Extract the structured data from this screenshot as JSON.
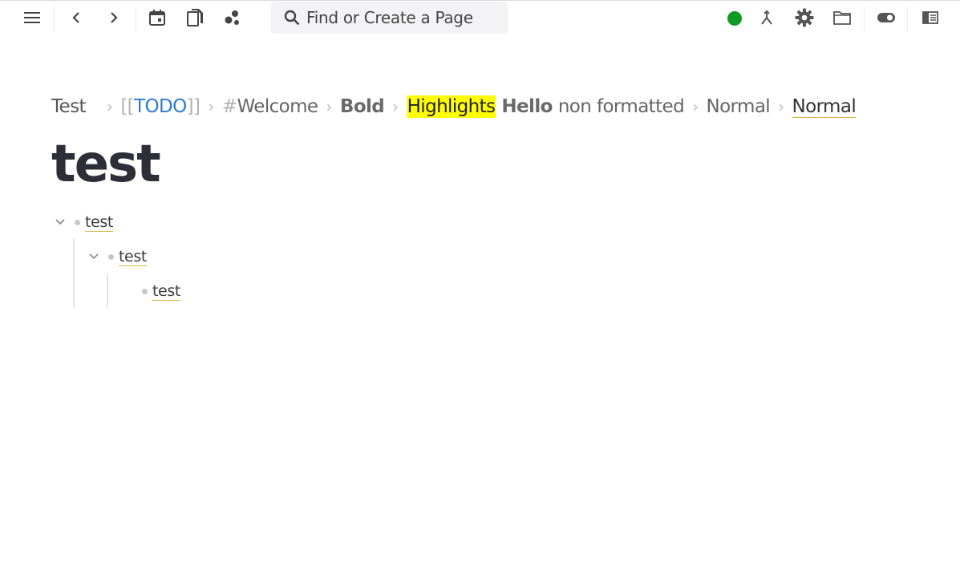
{
  "toolbar": {
    "search_placeholder": "Find or Create a Page"
  },
  "breadcrumb": {
    "page": "Test",
    "todo_open": "[[",
    "todo_text": "TODO",
    "todo_close": "]]",
    "tag_hash": "#",
    "tag_text": "Welcome",
    "bold": "Bold",
    "highlight": "Highlights",
    "hello": "Hello",
    "plain": "non formatted",
    "normal": "Normal",
    "normal_link": "Normal",
    "separator": "›"
  },
  "page": {
    "title": "test"
  },
  "blocks": [
    {
      "text": "test"
    },
    {
      "text": "test"
    },
    {
      "text": "test"
    }
  ],
  "colors": {
    "status": "#0e9a25",
    "highlight": "#ffff00",
    "link": "#2f7bd3"
  },
  "icons": [
    "menu-icon",
    "back-icon",
    "forward-icon",
    "calendar-icon",
    "pages-icon",
    "graph-icon",
    "search-icon",
    "merge-icon",
    "gear-icon",
    "folder-icon",
    "toggle-icon",
    "right-sidebar-icon"
  ]
}
